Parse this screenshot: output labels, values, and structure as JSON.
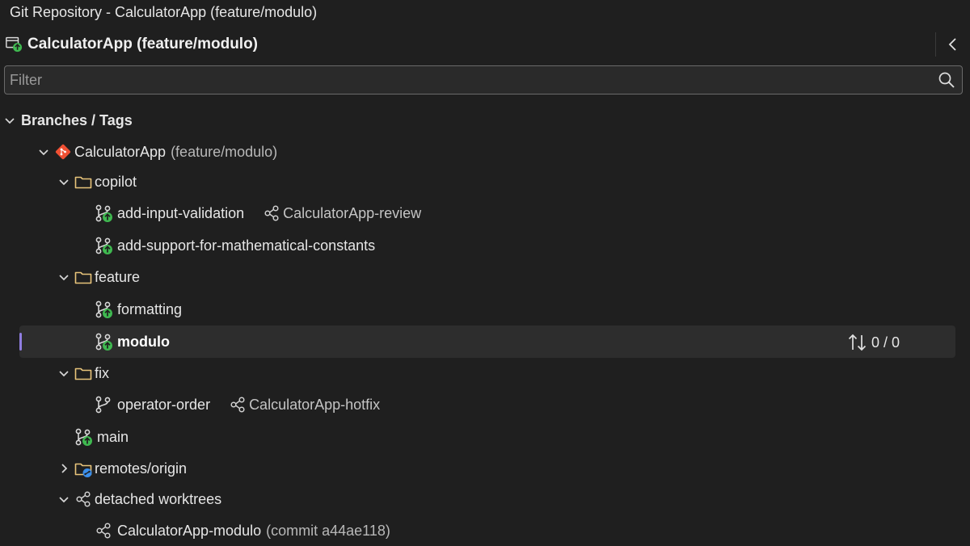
{
  "window": {
    "title": "Git Repository - CalculatorApp (feature/modulo)"
  },
  "header": {
    "repo_title": "CalculatorApp (feature/modulo)"
  },
  "filter": {
    "placeholder": "Filter",
    "value": ""
  },
  "tree": {
    "section_label": "Branches / Tags",
    "repo": {
      "name": "CalculatorApp",
      "branch": "(feature/modulo)"
    },
    "copilot": {
      "label": "copilot",
      "add_input_validation": "add-input-validation",
      "add_input_validation_worktree": "CalculatorApp-review",
      "add_support_constants": "add-support-for-mathematical-constants"
    },
    "feature": {
      "label": "feature",
      "formatting": "formatting",
      "modulo": "modulo",
      "modulo_sync": "0 / 0"
    },
    "fix": {
      "label": "fix",
      "operator_order": "operator-order",
      "operator_order_worktree": "CalculatorApp-hotfix"
    },
    "main": "main",
    "remotes": "remotes/origin",
    "detached": {
      "label": "detached worktrees",
      "modulo_worktree": "CalculatorApp-modulo",
      "modulo_commit": "(commit a44ae118)"
    }
  },
  "colors": {
    "background": "#1f1f1f",
    "selection": "#2d2d2d",
    "selection_bar": "#8f7de0",
    "git_red": "#f05033",
    "push_green": "#3fb950",
    "folder_yellow": "#e8c47a",
    "remote_blue": "#3b8eea"
  },
  "icons": {
    "branch_outgoing": "branch-outgoing-icon",
    "branch": "branch-icon",
    "worktree": "worktree-icon",
    "folder": "folder-icon",
    "remote_folder": "remote-folder-icon",
    "git": "git-logo-icon",
    "search": "search-icon"
  }
}
